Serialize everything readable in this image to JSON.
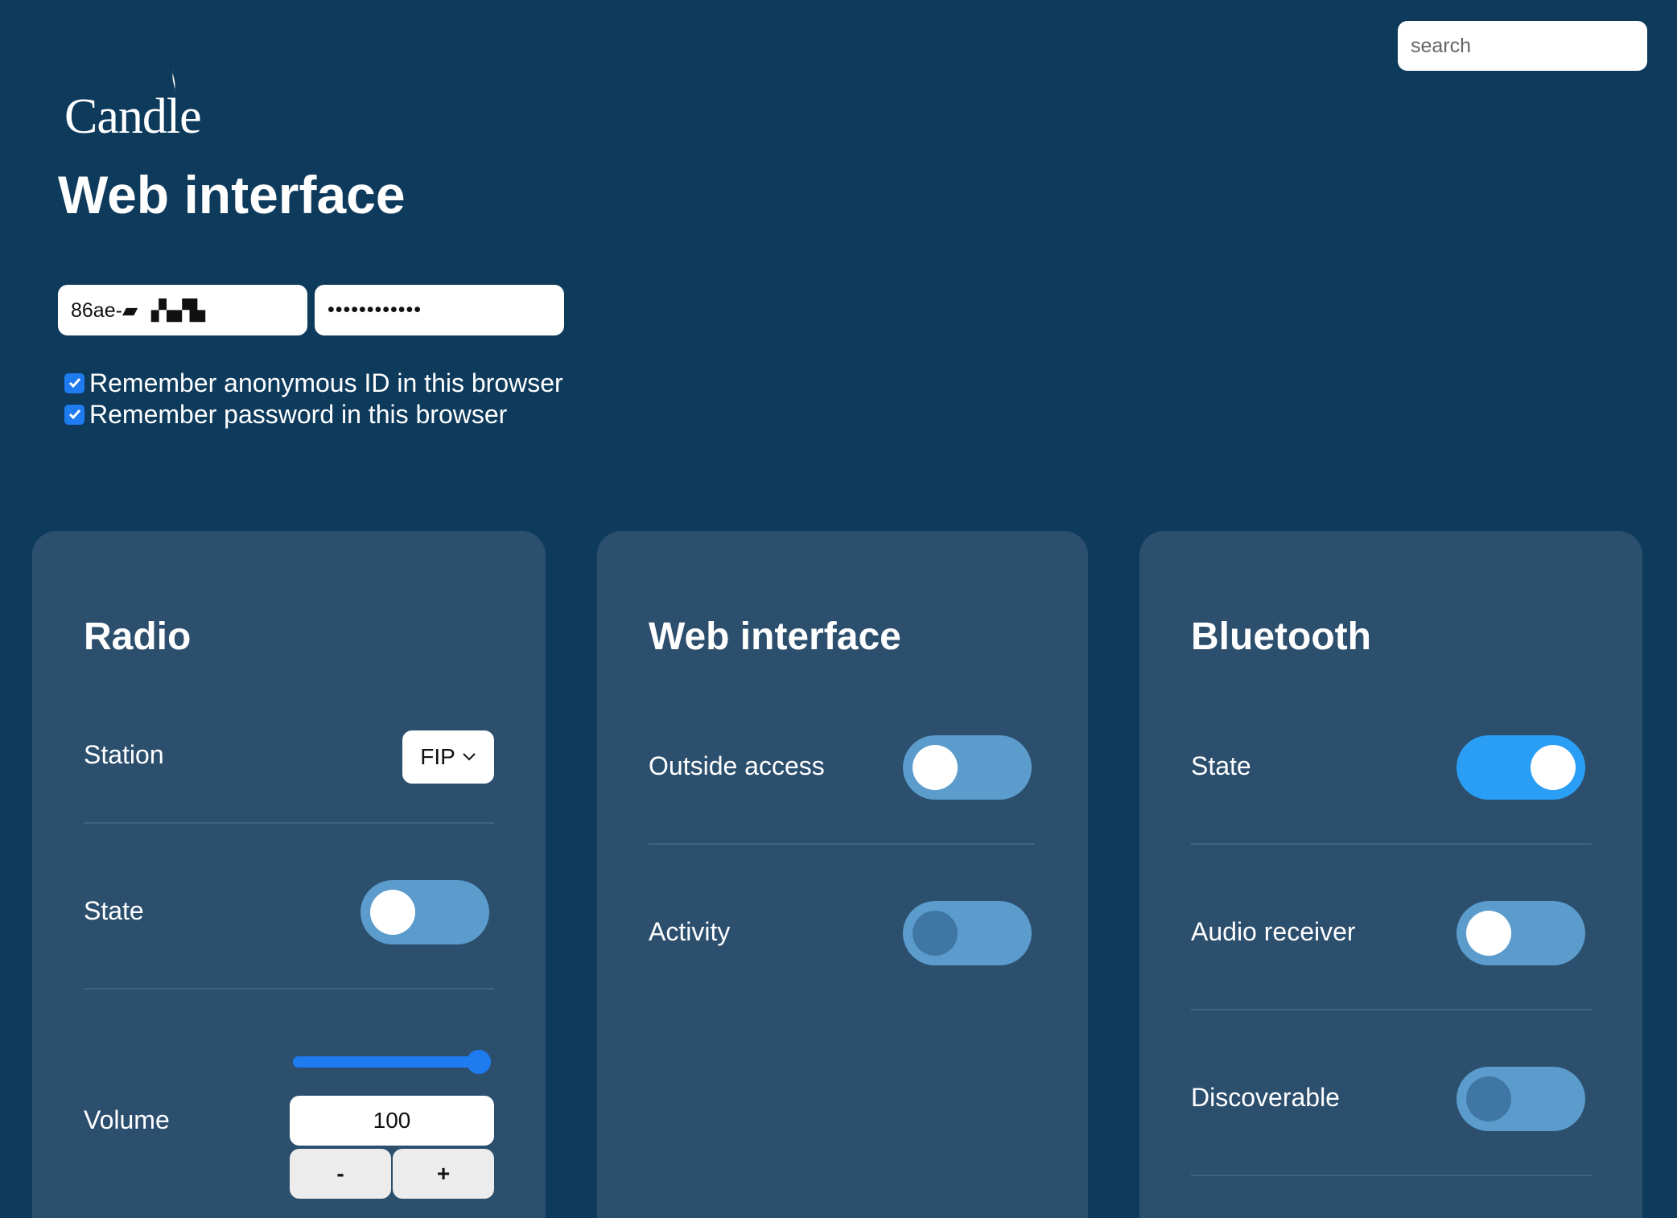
{
  "search": {
    "placeholder": "search"
  },
  "logo": {
    "text": "Candle"
  },
  "page_title": "Web interface",
  "credentials": {
    "anonymous_id_value": "86ae-▰ ▗▚▞▙",
    "password_value": "••••••••••••"
  },
  "remember": [
    {
      "label": "Remember anonymous ID in this browser",
      "checked": true
    },
    {
      "label": "Remember password in this browser",
      "checked": true
    }
  ],
  "cards": {
    "radio": {
      "title": "Radio",
      "station_label": "Station",
      "station_value": "FIP",
      "state_label": "State",
      "state_on": false,
      "volume_label": "Volume",
      "volume_value": "100",
      "volume_fraction": 1.0,
      "minus_label": "-",
      "plus_label": "+"
    },
    "web_interface": {
      "title": "Web interface",
      "outside_access_label": "Outside access",
      "outside_access_on": false,
      "activity_label": "Activity",
      "activity_on": false,
      "activity_disabled": true
    },
    "bluetooth": {
      "title": "Bluetooth",
      "state_label": "State",
      "state_on": true,
      "audio_receiver_label": "Audio receiver",
      "audio_receiver_on": false,
      "discoverable_label": "Discoverable",
      "discoverable_on": false,
      "discoverable_disabled": true
    }
  },
  "colors": {
    "background": "#0e3a5c",
    "card": "#2c4f6e",
    "toggle_off": "#5b9ccc",
    "toggle_on": "#2a9ef4",
    "accent": "#1e7bf0"
  }
}
